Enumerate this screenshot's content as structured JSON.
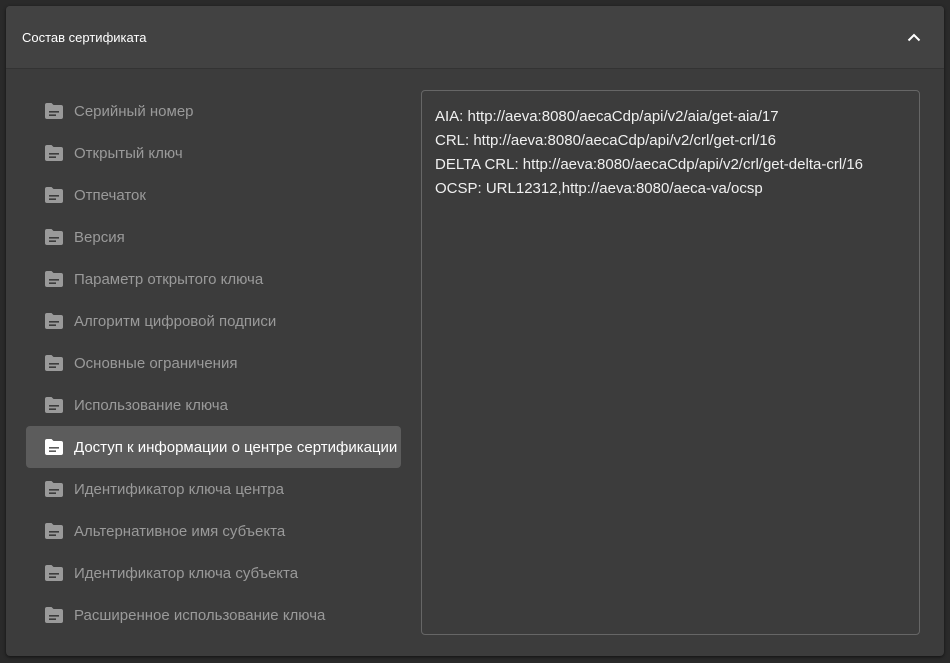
{
  "panel": {
    "title": "Состав сертификата"
  },
  "nav": {
    "items": [
      {
        "label": "Серийный номер",
        "active": false
      },
      {
        "label": "Открытый ключ",
        "active": false
      },
      {
        "label": "Отпечаток",
        "active": false
      },
      {
        "label": "Версия",
        "active": false
      },
      {
        "label": "Параметр открытого ключа",
        "active": false
      },
      {
        "label": "Алгоритм цифровой подписи",
        "active": false
      },
      {
        "label": "Основные ограничения",
        "active": false
      },
      {
        "label": "Использование ключа",
        "active": false
      },
      {
        "label": "Доступ к информации о центре сертификации",
        "active": true
      },
      {
        "label": "Идентификатор ключа центра",
        "active": false
      },
      {
        "label": "Альтернативное имя субъекта",
        "active": false
      },
      {
        "label": "Идентификатор ключа субъекта",
        "active": false
      },
      {
        "label": "Расширенное использование ключа",
        "active": false
      }
    ]
  },
  "detail": {
    "lines": [
      "AIA: http://aeva:8080/aecaCdp/api/v2/aia/get-aia/17",
      "CRL: http://aeva:8080/aecaCdp/api/v2/crl/get-crl/16",
      "DELTA CRL: http://aeva:8080/aecaCdp/api/v2/crl/get-delta-crl/16",
      "OCSP: URL12312,http://aeva:8080/aeca-va/ocsp"
    ]
  },
  "icons": {
    "collapse": "chevron-up-icon",
    "nav_item": "folder-icon"
  }
}
